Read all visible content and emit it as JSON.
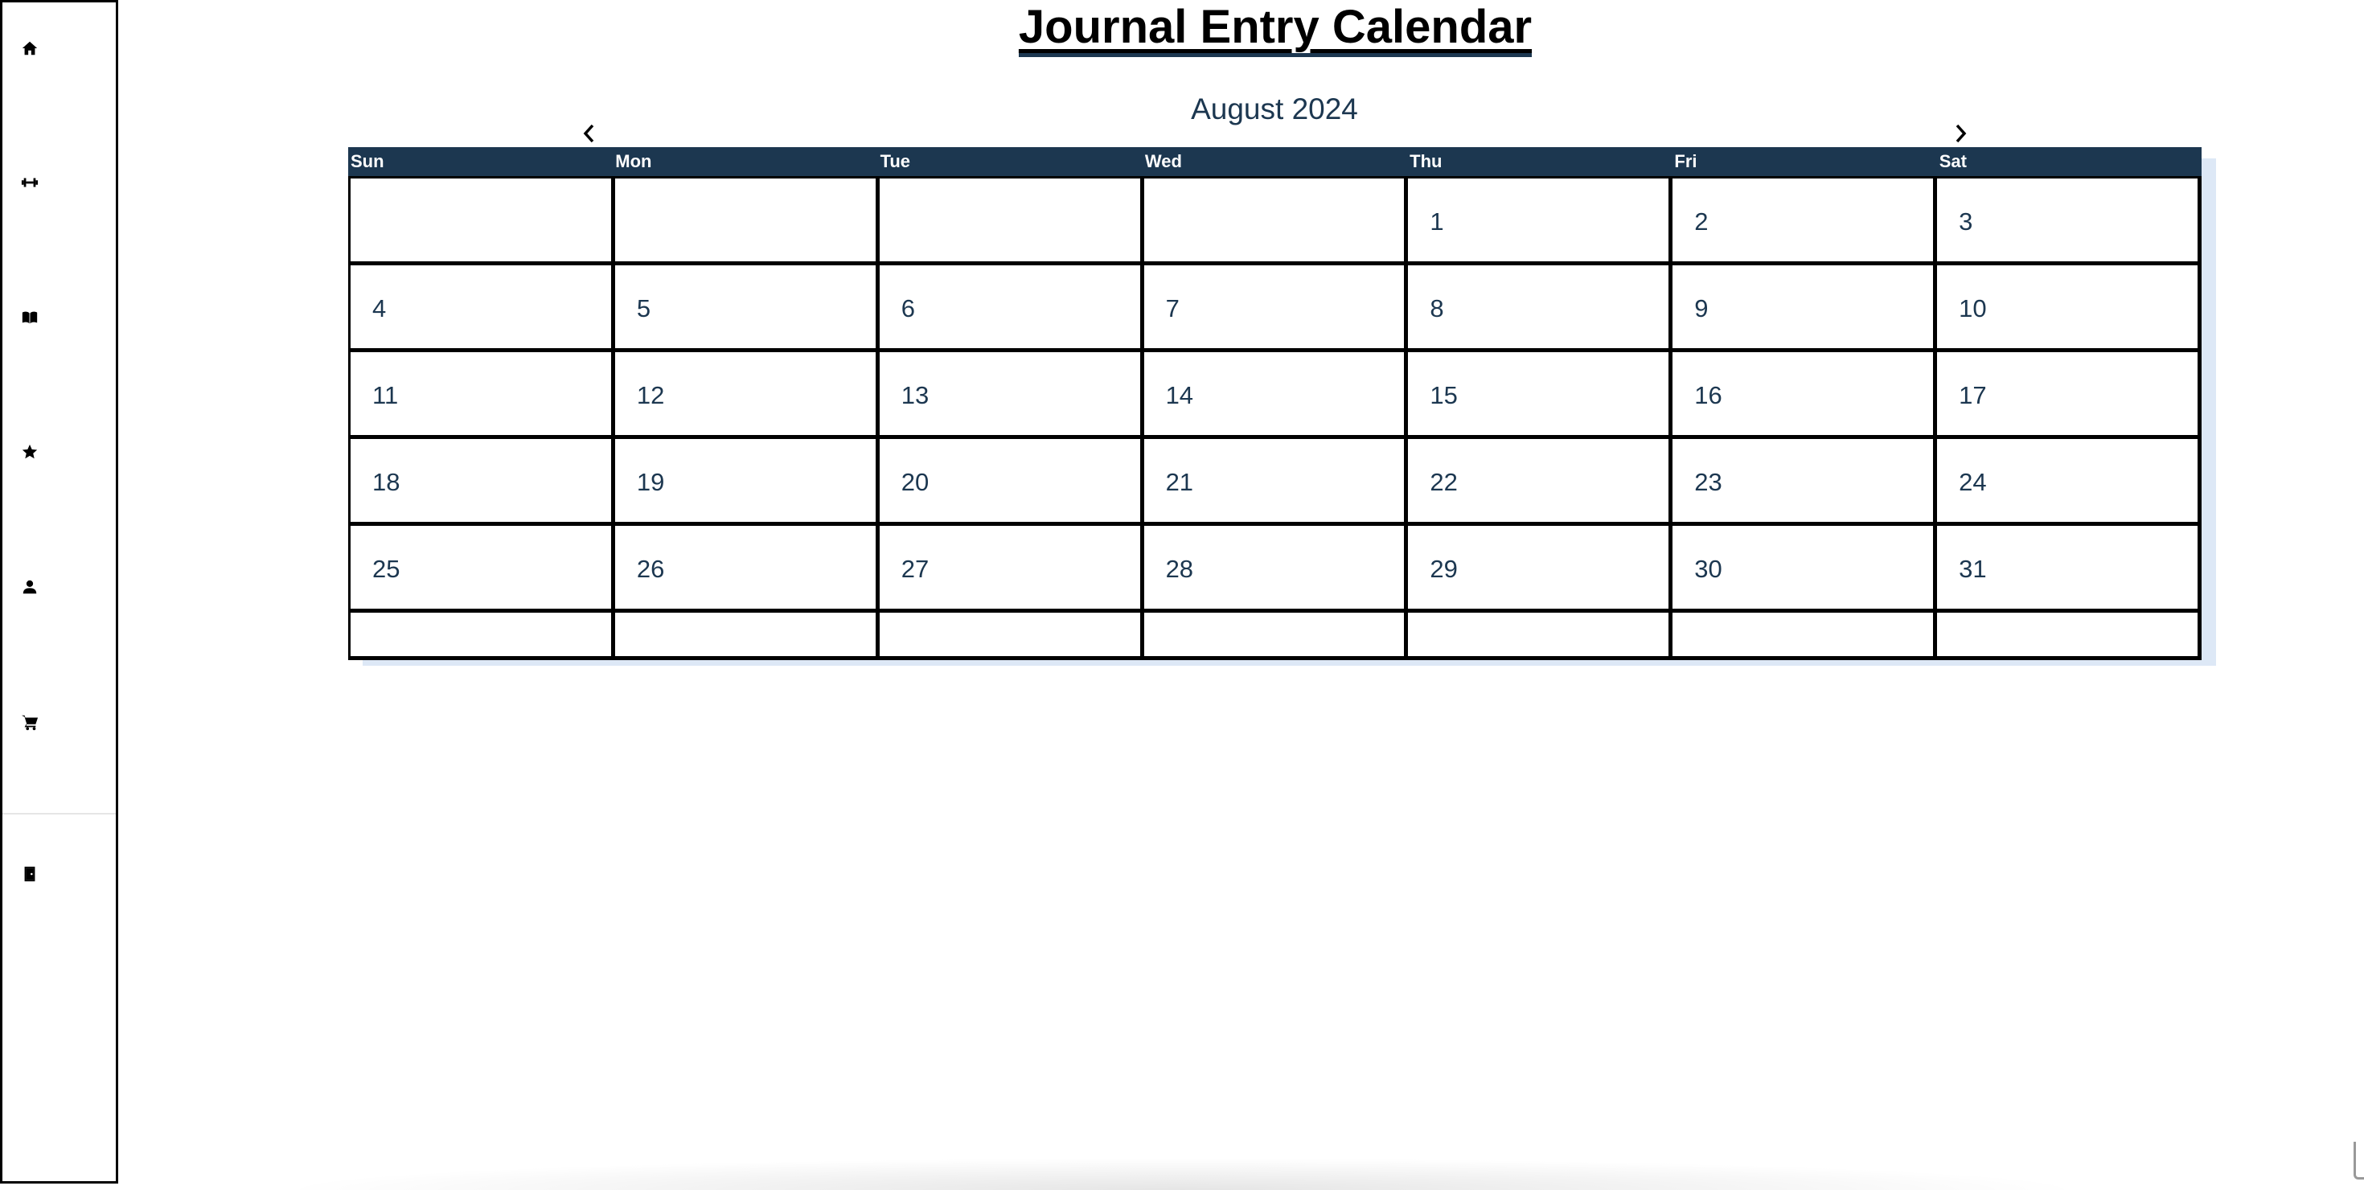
{
  "title": "Journal Entry Calendar",
  "sidebar": {
    "items": [
      {
        "icon": "home-icon"
      },
      {
        "icon": "dumbbell-icon"
      },
      {
        "icon": "book-icon"
      },
      {
        "icon": "star-icon"
      },
      {
        "icon": "user-icon"
      },
      {
        "icon": "cart-icon"
      }
    ],
    "footer_item": {
      "icon": "door-exit-icon"
    }
  },
  "calendar": {
    "month_label": "August 2024",
    "prev_icon": "chevron-left-icon",
    "next_icon": "chevron-right-icon",
    "weekdays": [
      "Sun",
      "Mon",
      "Tue",
      "Wed",
      "Thu",
      "Fri",
      "Sat"
    ],
    "weeks": [
      [
        "",
        "",
        "",
        "",
        "1",
        "2",
        "3"
      ],
      [
        "4",
        "5",
        "6",
        "7",
        "8",
        "9",
        "10"
      ],
      [
        "11",
        "12",
        "13",
        "14",
        "15",
        "16",
        "17"
      ],
      [
        "18",
        "19",
        "20",
        "21",
        "22",
        "23",
        "24"
      ],
      [
        "25",
        "26",
        "27",
        "28",
        "29",
        "30",
        "31"
      ],
      [
        "",
        "",
        "",
        "",
        "",
        "",
        ""
      ]
    ]
  },
  "colors": {
    "header_bg": "#1c3750",
    "day_text": "#1c3750",
    "shadow": "#dde8f6"
  }
}
